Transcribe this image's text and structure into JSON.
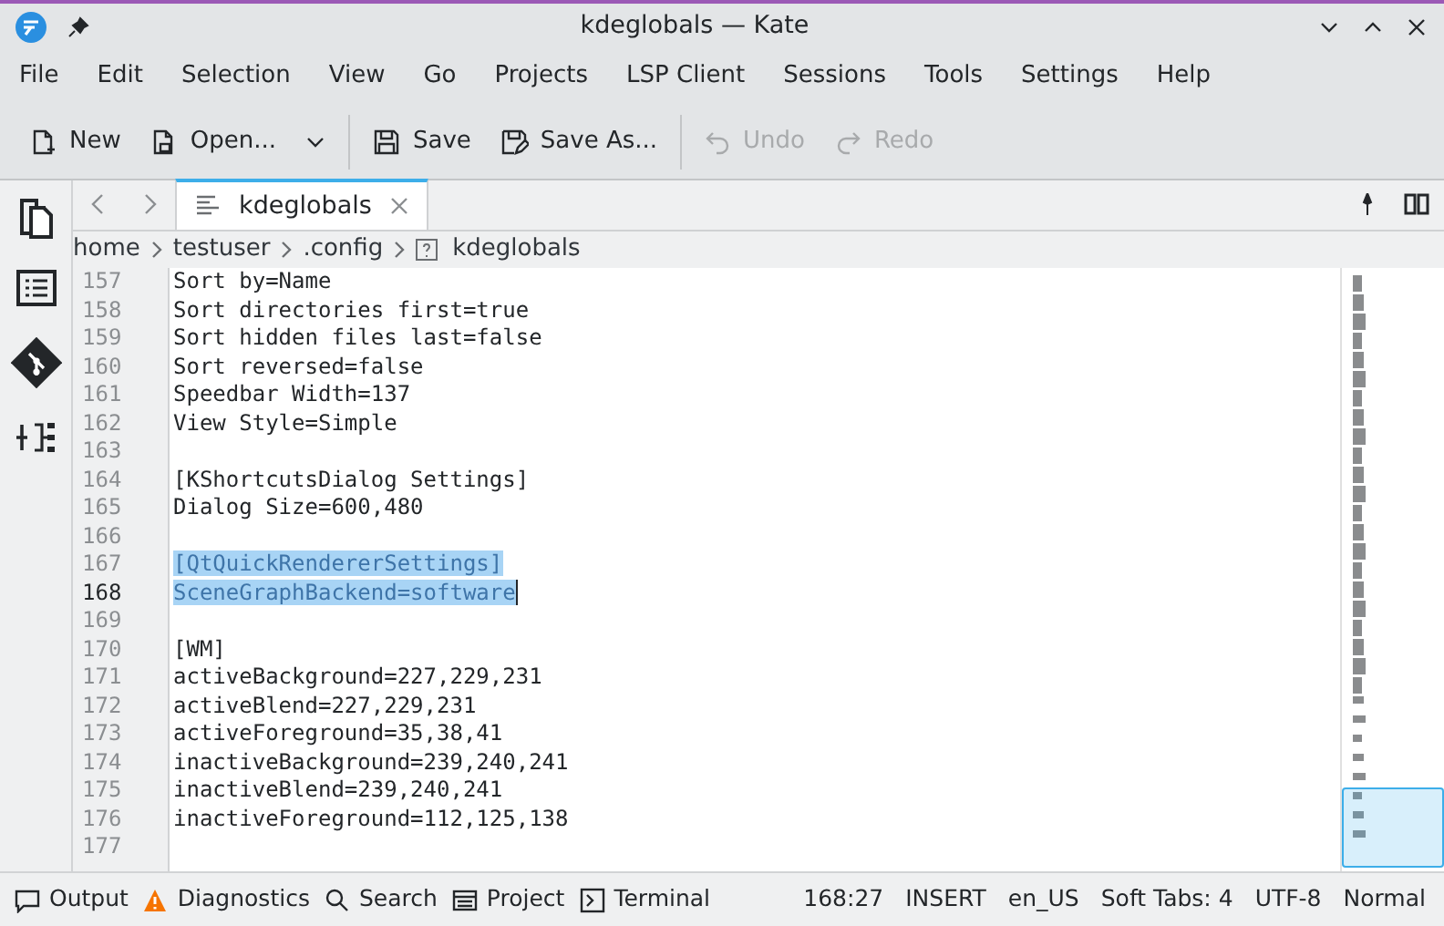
{
  "window": {
    "title": "kdeglobals — Kate"
  },
  "menu": [
    "File",
    "Edit",
    "Selection",
    "View",
    "Go",
    "Projects",
    "LSP Client",
    "Sessions",
    "Tools",
    "Settings",
    "Help"
  ],
  "toolbar": [
    {
      "kind": "new",
      "label": "New",
      "disabled": false
    },
    {
      "kind": "open",
      "label": "Open...",
      "disabled": false,
      "dropdown": true
    },
    {
      "kind": "save",
      "label": "Save",
      "disabled": false
    },
    {
      "kind": "saveas",
      "label": "Save As...",
      "disabled": false
    },
    {
      "kind": "undo",
      "label": "Undo",
      "disabled": true
    },
    {
      "kind": "redo",
      "label": "Redo",
      "disabled": true
    }
  ],
  "tabs": [
    {
      "label": "kdeglobals",
      "selected": true
    }
  ],
  "breadcrumb": [
    "home",
    "testuser",
    ".config",
    "kdeglobals"
  ],
  "lines": [
    {
      "number": "157",
      "text": "Sort by=Name",
      "selected": false,
      "current": false
    },
    {
      "number": "158",
      "text": "Sort directories first=true",
      "selected": false,
      "current": false
    },
    {
      "number": "159",
      "text": "Sort hidden files last=false",
      "selected": false,
      "current": false
    },
    {
      "number": "160",
      "text": "Sort reversed=false",
      "selected": false,
      "current": false
    },
    {
      "number": "161",
      "text": "Speedbar Width=137",
      "selected": false,
      "current": false
    },
    {
      "number": "162",
      "text": "View Style=Simple",
      "selected": false,
      "current": false
    },
    {
      "number": "163",
      "current": false
    },
    {
      "number": "164",
      "text": "[KShortcutsDialog Settings]",
      "selected": false,
      "current": false
    },
    {
      "number": "165",
      "text": "Dialog Size=600,480",
      "selected": false,
      "current": false
    },
    {
      "number": "166",
      "current": false
    },
    {
      "number": "167",
      "text": "[QtQuickRendererSettings]",
      "selected": true,
      "current": false
    },
    {
      "number": "168",
      "text": "SceneGraphBackend=software",
      "selected": true,
      "current": true
    },
    {
      "number": "169",
      "current": false
    },
    {
      "number": "170",
      "text": "[WM]",
      "selected": false,
      "current": false
    },
    {
      "number": "171",
      "text": "activeBackground=227,229,231",
      "selected": false,
      "current": false
    },
    {
      "number": "172",
      "text": "activeBlend=227,229,231",
      "selected": false,
      "current": false
    },
    {
      "number": "173",
      "text": "activeForeground=35,38,41",
      "selected": false,
      "current": false
    },
    {
      "number": "174",
      "text": "inactiveBackground=239,240,241",
      "selected": false,
      "current": false
    },
    {
      "number": "175",
      "text": "inactiveBlend=239,240,241",
      "selected": false,
      "current": false
    },
    {
      "number": "176",
      "text": "inactiveForeground=112,125,138",
      "selected": false,
      "current": false
    },
    {
      "number": "177",
      "current": false
    }
  ],
  "panels": [
    {
      "kind": "output",
      "label": "Output"
    },
    {
      "kind": "diagnostics",
      "label": "Diagnostics"
    },
    {
      "kind": "search",
      "label": "Search"
    },
    {
      "kind": "project",
      "label": "Project"
    },
    {
      "kind": "terminal",
      "label": "Terminal"
    }
  ],
  "status": [
    "168:27",
    "INSERT",
    "en_US",
    "Soft Tabs: 4",
    "UTF-8",
    "Normal"
  ]
}
